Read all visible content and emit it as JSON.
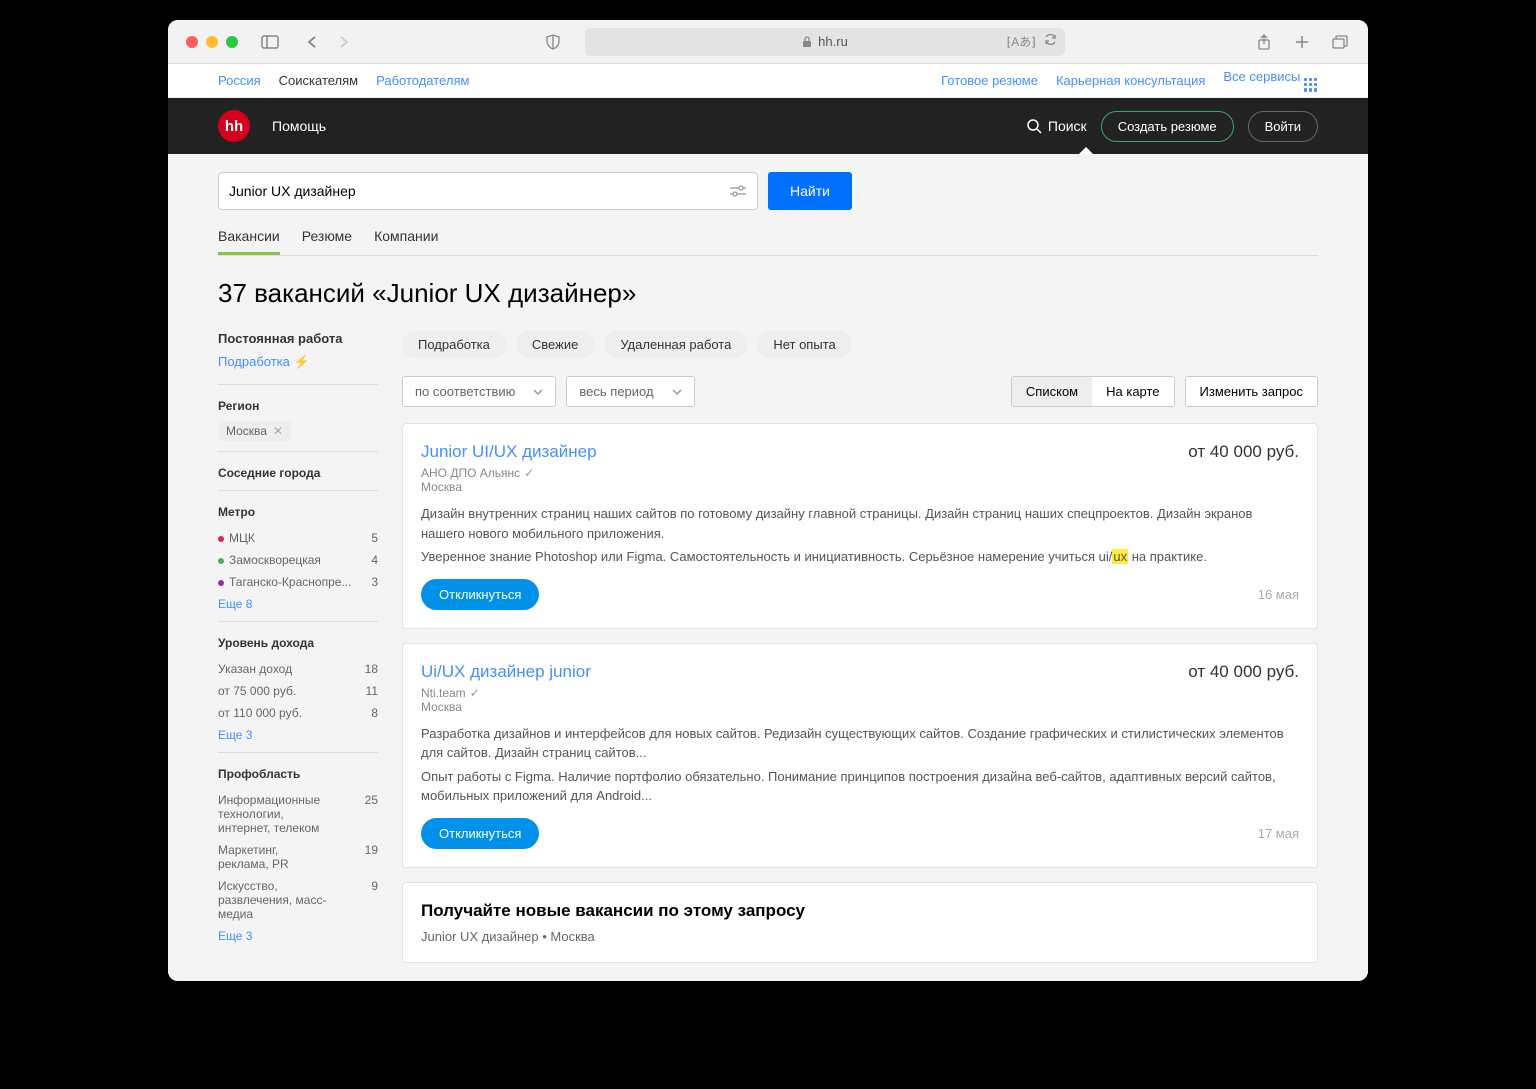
{
  "browser": {
    "url": "hh.ru"
  },
  "topnav": {
    "region": "Россия",
    "seekers": "Соискателям",
    "employers": "Работодателям",
    "resume": "Готовое резюме",
    "consult": "Карьерная консультация",
    "services": "Все сервисы"
  },
  "header": {
    "logo": "hh",
    "help": "Помощь",
    "search": "Поиск",
    "create": "Создать резюме",
    "login": "Войти"
  },
  "search": {
    "value": "Junior UX дизайнер",
    "button": "Найти"
  },
  "tabs": [
    "Вакансии",
    "Резюме",
    "Компании"
  ],
  "heading": "37 вакансий «Junior UX дизайнер»",
  "sidebar": {
    "permanent": "Постоянная работа",
    "parttime": "Подработка",
    "region_label": "Регион",
    "region": "Москва",
    "neighbors": "Соседние города",
    "metro_label": "Метро",
    "metro": [
      {
        "name": "МЦК",
        "count": "5",
        "color": "#e91e63"
      },
      {
        "name": "Замоскворецкая",
        "count": "4",
        "color": "#4caf50"
      },
      {
        "name": "Таганско-Краснопре...",
        "count": "3",
        "color": "#9c27b0"
      }
    ],
    "metro_more": "Еще 8",
    "income_label": "Уровень дохода",
    "income": [
      {
        "name": "Указан доход",
        "count": "18"
      },
      {
        "name": "от 75 000 руб.",
        "count": "11"
      },
      {
        "name": "от 110 000 руб.",
        "count": "8"
      }
    ],
    "income_more": "Еще 3",
    "prof_label": "Профобласть",
    "prof": [
      {
        "name": "Информационные технологии, интернет, телеком",
        "count": "25"
      },
      {
        "name": "Маркетинг, реклама, PR",
        "count": "19"
      },
      {
        "name": "Искусство, развлечения, масс-медиа",
        "count": "9"
      }
    ],
    "prof_more": "Еще 3"
  },
  "pills": [
    "Подработка",
    "Свежие",
    "Удаленная работа",
    "Нет опыта"
  ],
  "sort": "по соответствию",
  "period": "весь период",
  "view": {
    "list": "Списком",
    "map": "На карте"
  },
  "change": "Изменить запрос",
  "vacancies": [
    {
      "title": "Junior UI/UX дизайнер",
      "salary": "от 40 000 руб.",
      "company": "АНО ДПО Альянс",
      "city": "Москва",
      "desc1": "Дизайн внутренних страниц наших сайтов по готовому дизайну главной страницы. Дизайн страниц наших спецпроектов. Дизайн экранов нашего нового мобильного приложения.",
      "desc2_pre": "Уверенное знание Photoshop или Figma. Самостоятельность и инициативность. Серьёзное намерение учиться ui/",
      "desc2_hl": "ux",
      "desc2_post": " на практике.",
      "apply": "Откликнуться",
      "date": "16 мая"
    },
    {
      "title": "Ui/UX дизайнер junior",
      "salary": "от 40 000 руб.",
      "company": "Nti.team",
      "city": "Москва",
      "desc1": "Разработка дизайнов и интерфейсов для новых сайтов. Редизайн существующих сайтов. Создание графических и стилистических элементов для сайтов. Дизайн страниц сайтов...",
      "desc2": "Опыт работы с Figma. Наличие портфолио обязательно. Понимание принципов построения дизайна веб-сайтов, адаптивных версий сайтов, мобильных приложений для Android...",
      "apply": "Откликнуться",
      "date": "17 мая"
    }
  ],
  "subscribe": {
    "title": "Получайте новые вакансии по этому запросу",
    "sub": "Junior UX дизайнер • Москва"
  }
}
